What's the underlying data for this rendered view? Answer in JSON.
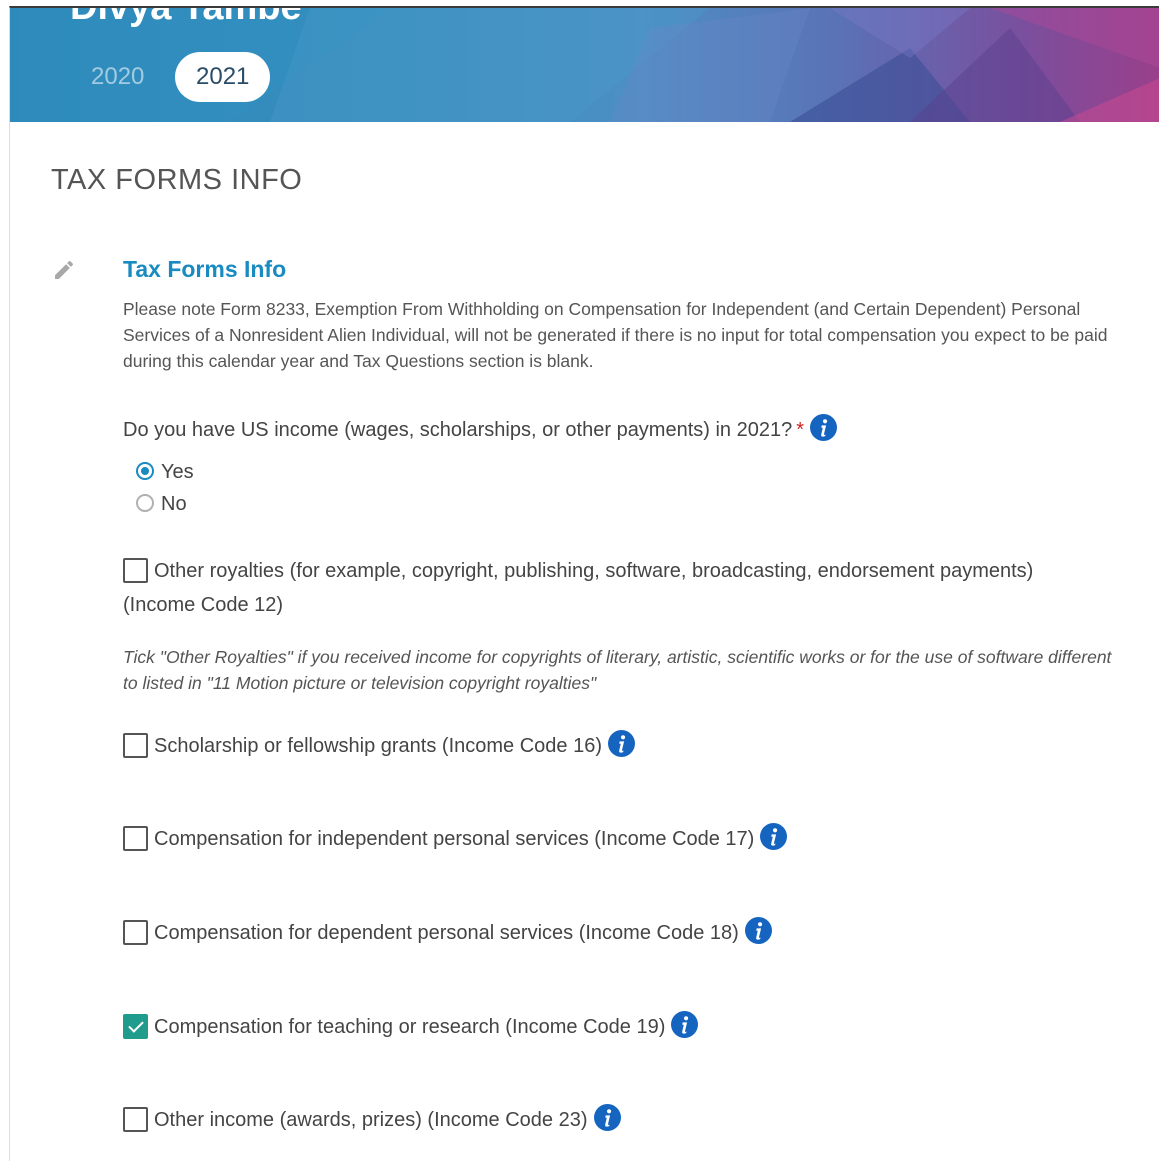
{
  "header": {
    "user_name": "Divya Tambe",
    "years": [
      "2020",
      "2021"
    ],
    "selected_year": "2021"
  },
  "section_heading": "TAX FORMS INFO",
  "form": {
    "title": "Tax Forms Info",
    "note": "Please note Form 8233, Exemption From Withholding on Compensation for Independent (and Certain Dependent) Personal Services of a Nonresident Alien Individual, will not be generated if there is no input for total compensation you expect to be paid during this calendar year and Tax Questions section is blank.",
    "question": "Do you have US income (wages, scholarships, or other payments) in 2021?",
    "required_marker": "*",
    "options": [
      {
        "label": "Yes",
        "selected": true
      },
      {
        "label": "No",
        "selected": false
      }
    ],
    "income_types": [
      {
        "label": "Other royalties (for example, copyright, publishing, software, broadcasting, endorsement payments)",
        "label_line2": "(Income Code 12)",
        "checked": false,
        "info": false,
        "hint": "Tick \"Other Royalties\" if you received income for copyrights of literary, artistic, scientific works or for the use of software different to listed in \"11 Motion picture or television copyright royalties\""
      },
      {
        "label": "Scholarship or fellowship grants (Income Code 16)",
        "checked": false,
        "info": true
      },
      {
        "label": "Compensation for independent personal services (Income Code 17)",
        "checked": false,
        "info": true
      },
      {
        "label": "Compensation for dependent personal services (Income Code 18)",
        "checked": false,
        "info": true
      },
      {
        "label": "Compensation for teaching or research (Income Code 19)",
        "checked": true,
        "info": true
      },
      {
        "label": "Other income (awards, prizes) (Income Code 23)",
        "checked": false,
        "info": true
      }
    ]
  },
  "colors": {
    "accent": "#1a8bc1",
    "checked": "#1f9c8c",
    "info_icon": "#1565c0",
    "required": "#cc2222"
  }
}
